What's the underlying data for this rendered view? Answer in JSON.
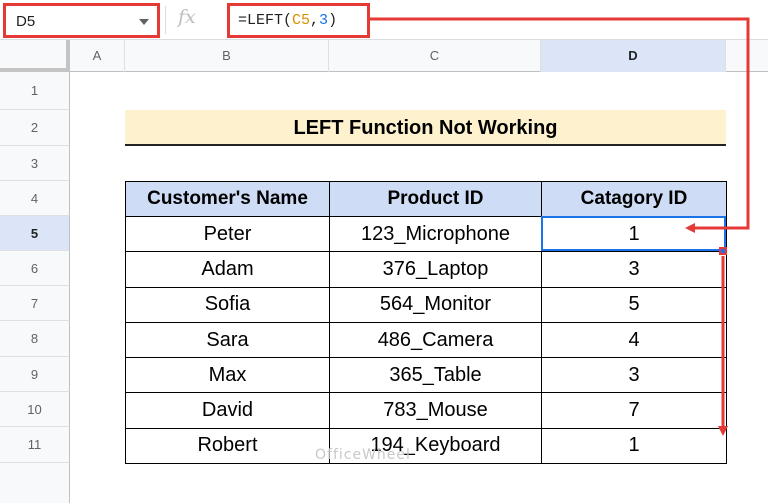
{
  "name_box": {
    "value": "D5"
  },
  "formula": {
    "prefix": "=LEFT(",
    "ref": "C5",
    "sep": ",",
    "arg": "3",
    "suffix": ")"
  },
  "columns": [
    "A",
    "B",
    "C",
    "D"
  ],
  "rows": [
    "1",
    "2",
    "3",
    "4",
    "5",
    "6",
    "7",
    "8",
    "9",
    "10",
    "11"
  ],
  "title": "LEFT Function Not Working",
  "table": {
    "headers": [
      "Customer's Name",
      "Product ID",
      "Catagory ID"
    ],
    "rows": [
      [
        "Peter",
        "123_Microphone",
        "1"
      ],
      [
        "Adam",
        "376_Laptop",
        "3"
      ],
      [
        "Sofia",
        "564_Monitor",
        "5"
      ],
      [
        "Sara",
        "486_Camera",
        "4"
      ],
      [
        "Max",
        "365_Table",
        "3"
      ],
      [
        "David",
        "783_Mouse",
        "7"
      ],
      [
        "Robert",
        "194_Keyboard",
        "1"
      ]
    ]
  },
  "watermark": "OfficeWheel",
  "colors": {
    "highlight": "#e53935",
    "selection": "#1a73e8",
    "title_bg": "#fdf2cd",
    "header_bg": "#cfdcf6"
  }
}
